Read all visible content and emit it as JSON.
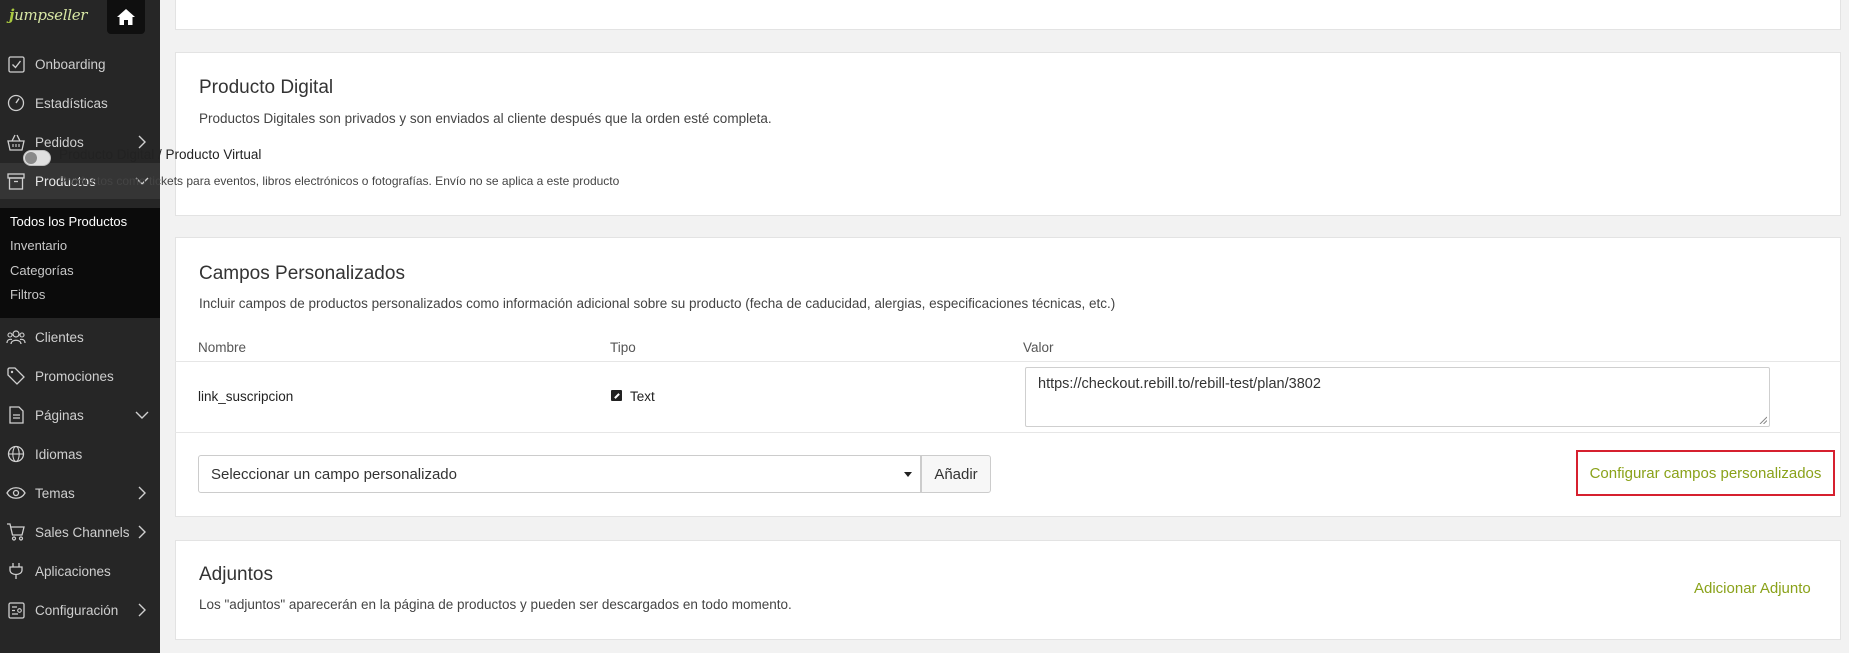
{
  "brand": {
    "logo_first": "j",
    "logo_rest": "umpseller"
  },
  "sidebar": {
    "items": [
      {
        "label": "Onboarding",
        "icon": "check-square-icon"
      },
      {
        "label": "Estadísticas",
        "icon": "gauge-icon"
      },
      {
        "label": "Pedidos",
        "icon": "basket-icon"
      },
      {
        "label": "Productos",
        "icon": "box-icon"
      },
      {
        "label": "Clientes",
        "icon": "users-icon"
      },
      {
        "label": "Promociones",
        "icon": "tag-icon"
      },
      {
        "label": "Páginas",
        "icon": "page-icon"
      },
      {
        "label": "Idiomas",
        "icon": "globe-icon"
      },
      {
        "label": "Temas",
        "icon": "eye-icon"
      },
      {
        "label": "Sales Channels",
        "icon": "cart-icon"
      },
      {
        "label": "Aplicaciones",
        "icon": "plug-icon"
      },
      {
        "label": "Configuración",
        "icon": "settings-icon"
      }
    ],
    "submenu": [
      "Todos los Productos",
      "Inventario",
      "Categorías",
      "Filtros"
    ]
  },
  "digital": {
    "title": "Producto Digital",
    "description": "Productos Digitales son privados y son enviados al cliente después que la orden esté completa.",
    "toggle_label": "Producto Digital / Producto Virtual",
    "toggle_help": "Productos como tickets para eventos, libros electrónicos o fotografías. Envío no se aplica a este producto"
  },
  "custom_fields": {
    "title": "Campos Personalizados",
    "description": "Incluir campos de productos personalizados como información adicional sobre su producto (fecha de caducidad, alergias, especificaciones técnicas, etc.)",
    "headers": {
      "name": "Nombre",
      "type": "Tipo",
      "value": "Valor"
    },
    "rows": [
      {
        "name": "link_suscripcion",
        "type": "Text",
        "value": "https://checkout.rebill.to/rebill-test/plan/3802"
      }
    ],
    "select_placeholder": "Seleccionar un campo personalizado",
    "add_label": "Añadir",
    "config_label": "Configurar campos personalizados"
  },
  "attachments": {
    "title": "Adjuntos",
    "description": "Los \"adjuntos\" aparecerán en la página de productos y pueden ser descargados en todo momento.",
    "add_label": "Adicionar Adjunto"
  },
  "colors": {
    "accent": "#8aa21a",
    "highlight": "#d6202f",
    "sidebar": "#262626"
  }
}
